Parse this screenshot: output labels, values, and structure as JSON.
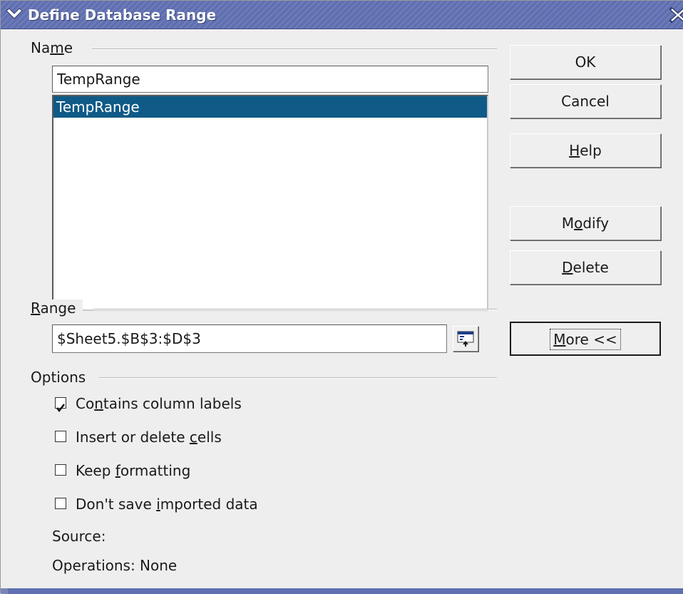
{
  "window": {
    "title": "Define Database Range",
    "title_bar_color": "#5f6fb0",
    "menu_icon": "chevron-down-icon",
    "close_icon": "close-icon"
  },
  "name_section": {
    "label": "Name",
    "mnemonic": "m",
    "input_value": "TempRange",
    "list_items": [
      {
        "label": "TempRange",
        "selected": true
      }
    ],
    "selection_color": "#0f5a87"
  },
  "range_section": {
    "label": "Range",
    "mnemonic": "R",
    "input_value": "$Sheet5.$B$3:$D$3",
    "shrink_icon": "shrink-dialog-icon"
  },
  "options_section": {
    "label": "Options",
    "checkboxes": [
      {
        "label": "Contains column labels",
        "mnemonic": "n",
        "checked": true
      },
      {
        "label": "Insert or delete cells",
        "mnemonic": "c",
        "checked": false
      },
      {
        "label": "Keep formatting",
        "mnemonic": "f",
        "checked": false
      },
      {
        "label": "Don't save imported data",
        "mnemonic": "i",
        "checked": false
      }
    ],
    "source_label": "Source:",
    "operations_label": "Operations: None"
  },
  "buttons": {
    "ok": "OK",
    "cancel": "Cancel",
    "help": "Help",
    "modify": "Modify",
    "delete": "Delete",
    "more": "More <<"
  }
}
